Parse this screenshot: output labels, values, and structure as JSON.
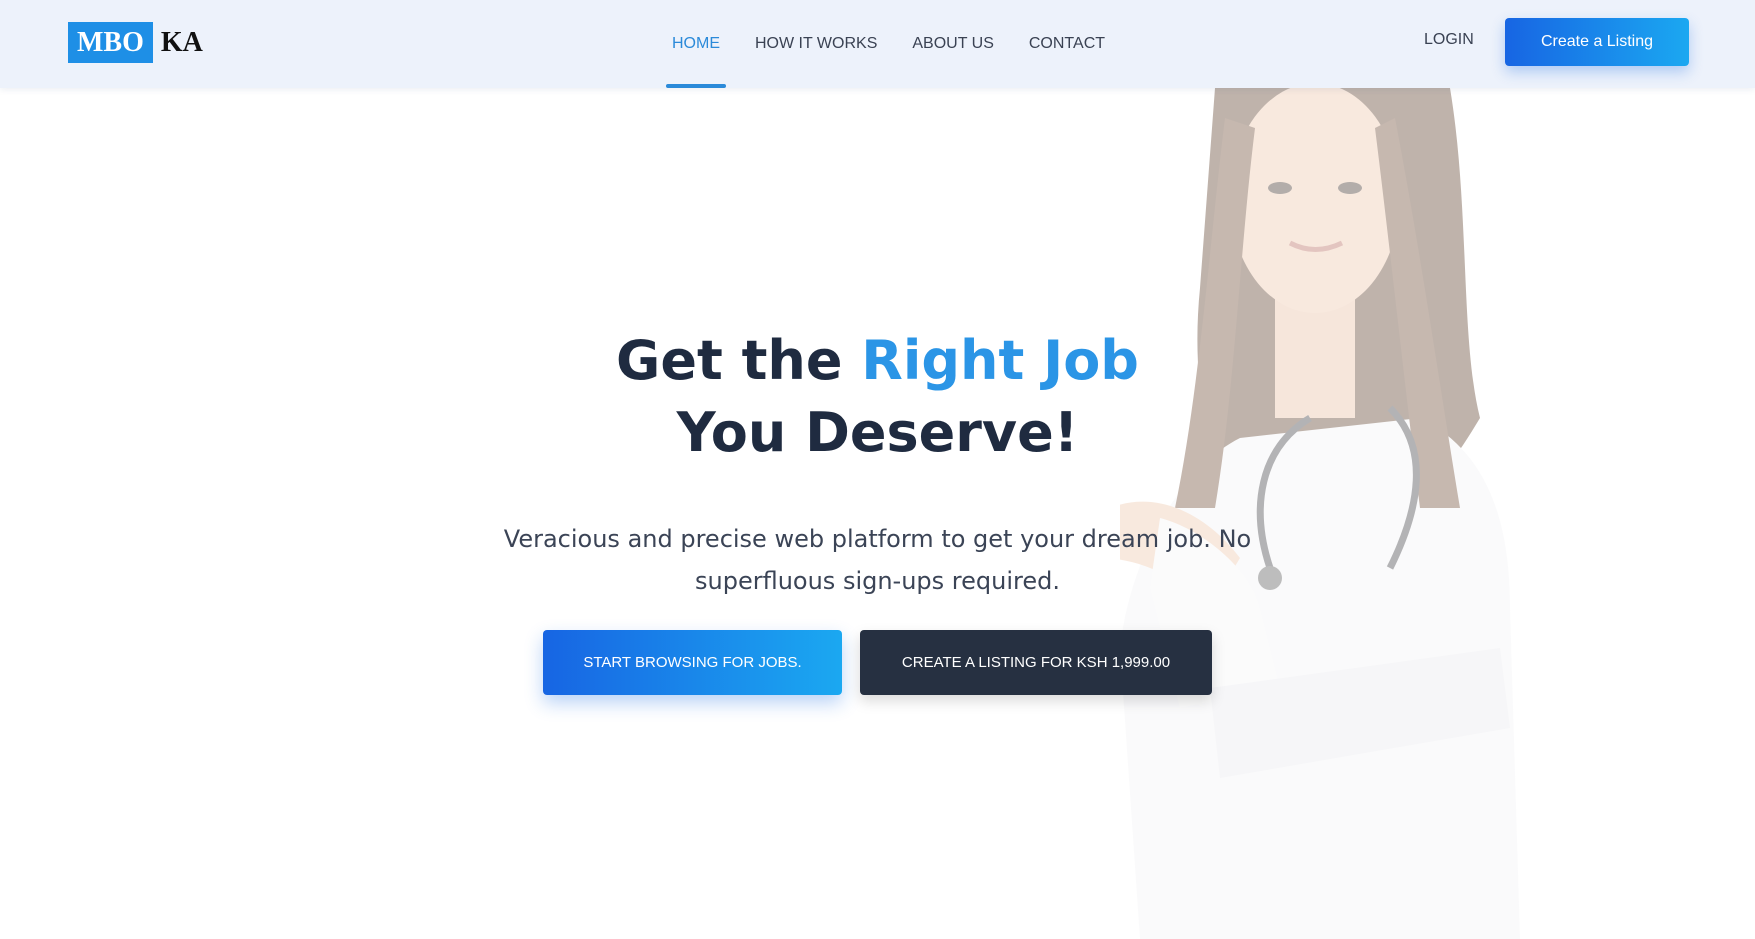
{
  "logo": {
    "box_text": "MBO",
    "rest_text": "KA"
  },
  "nav": {
    "items": [
      {
        "label": "HOME",
        "active": true
      },
      {
        "label": "HOW IT WORKS",
        "active": false
      },
      {
        "label": "ABOUT US",
        "active": false
      },
      {
        "label": "CONTACT",
        "active": false
      }
    ],
    "login": "LOGIN",
    "create_listing": "Create a Listing"
  },
  "hero": {
    "headline_prefix": "Get the ",
    "headline_highlight": "Right Job",
    "headline_line2": "You Deserve!",
    "subtitle": "Veracious and precise web platform to get your dream job. No superfluous sign-ups required.",
    "primary_button": "START BROWSING FOR JOBS.",
    "secondary_button": "CREATE A LISTING FOR KSH 1,999.00",
    "image": "doctor-pointing-image"
  },
  "colors": {
    "accent": "#2b8ad9",
    "gradient_start": "#1765e3",
    "gradient_end": "#1ba8f1",
    "dark": "#1f2b40",
    "header_bg": "#edf2fb"
  }
}
